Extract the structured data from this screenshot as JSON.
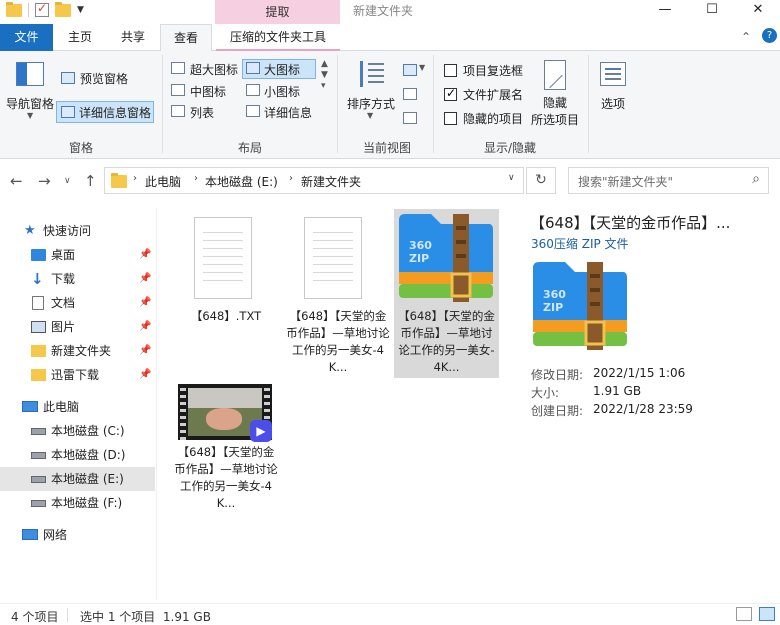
{
  "window": {
    "title": "新建文件夹",
    "context_tab": "提取",
    "minimize": "—",
    "maximize": "☐",
    "close": "✕"
  },
  "tabs": [
    {
      "label": "文件"
    },
    {
      "label": "主页"
    },
    {
      "label": "共享"
    },
    {
      "label": "查看"
    },
    {
      "label": "压缩的文件夹工具"
    }
  ],
  "ribbon": {
    "panes": {
      "label": "窗格",
      "nav_pane": "导航窗格",
      "preview_pane": "预览窗格",
      "details_pane": "详细信息窗格"
    },
    "layout": {
      "label": "布局",
      "items": [
        "超大图标",
        "大图标",
        "中图标",
        "小图标",
        "列表",
        "详细信息"
      ]
    },
    "current_view": {
      "label": "当前视图",
      "sort": "排序方式"
    },
    "show_hide": {
      "label": "显示/隐藏",
      "item_checkboxes": "项目复选框",
      "file_extensions": "文件扩展名",
      "hidden_items": "隐藏的项目",
      "hide_selected_1": "隐藏",
      "hide_selected_2": "所选项目"
    },
    "options": "选项"
  },
  "address": {
    "crumbs": [
      "此电脑",
      "本地磁盘 (E:)",
      "新建文件夹"
    ],
    "search_placeholder": "搜索\"新建文件夹\""
  },
  "nav": {
    "quick_access": "快速访问",
    "pinned": [
      {
        "label": "桌面"
      },
      {
        "label": "下载"
      },
      {
        "label": "文档"
      },
      {
        "label": "图片"
      },
      {
        "label": "新建文件夹"
      },
      {
        "label": "迅雷下载"
      }
    ],
    "this_pc": "此电脑",
    "drives": [
      {
        "label": "本地磁盘 (C:)"
      },
      {
        "label": "本地磁盘 (D:)"
      },
      {
        "label": "本地磁盘 (E:)"
      },
      {
        "label": "本地磁盘 (F:)"
      }
    ],
    "network": "网络"
  },
  "files": [
    {
      "name": "【648】.TXT",
      "kind": "text-file-icon"
    },
    {
      "name": "【648】【天堂的金币作品】—草地讨论工作的另一美女-4K...",
      "kind": "text-file-icon"
    },
    {
      "name": "【648】【天堂的金币作品】—草地讨论工作的另一美女-4K...",
      "kind": "zip-archive-icon"
    },
    {
      "name": "【648】【天堂的金币作品】—草地讨论工作的另一美女-4K...",
      "kind": "video-file-icon"
    }
  ],
  "preview": {
    "title": "【648】【天堂的金币作品】...",
    "type": "360压缩 ZIP 文件",
    "zip_text": "360\nZIP",
    "modified_label": "修改日期:",
    "modified": "2022/1/15 1:06",
    "size_label": "大小:",
    "size": "1.91 GB",
    "created_label": "创建日期:",
    "created": "2022/1/28 23:59"
  },
  "status": {
    "count": "4 个项目",
    "selected": "选中 1 个项目  1.91 GB"
  },
  "colors": {
    "accent": "#1a6fc1",
    "selection": "#cce4f7",
    "zip_blue": "#2a8de6",
    "zip_strap": "#8a5a2b"
  }
}
